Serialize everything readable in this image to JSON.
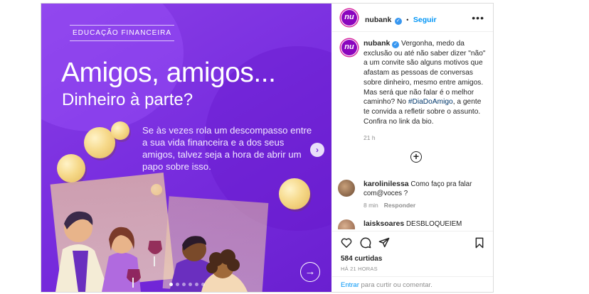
{
  "post_image": {
    "category": "EDUCAÇÃO FINANCEIRA",
    "headline": "Amigos, amigos...",
    "subheadline": "Dinheiro à parte?",
    "body": "Se às vezes rola um descompasso entre a sua vida financeira e a dos seus amigos, talvez seja a hora de abrir um papo sobre isso.",
    "next_arrow": "›",
    "carousel_dots": 6,
    "active_dot": 0,
    "circle_arrow": "→"
  },
  "header": {
    "avatar_text": "nu",
    "username": "nubank",
    "separator": "•",
    "follow_label": "Seguir",
    "more_icon": "•••"
  },
  "caption": {
    "avatar_text": "nu",
    "username": "nubank",
    "text_before_hashtag": "Vergonha, medo da exclusão ou até não saber dizer \"não\" a um convite são alguns motivos que afastam as pessoas de conversas sobre dinheiro, mesmo entre amigos. Mas será que não falar é o melhor caminho? No ",
    "hashtag": "#DiaDoAmigo",
    "text_after_hashtag": ", a gente te convida a refletir sobre o assunto. Confira no link da bio.",
    "time": "21 h"
  },
  "load_more_icon": "+",
  "comments": [
    {
      "username": "karolinilessa",
      "text": "Como faço pra falar com@voces ?",
      "time": "8 min",
      "reply_label": "Responder"
    },
    {
      "username": "laisksoares",
      "text": "DESBLOQUEIEM NINHA"
    }
  ],
  "stats": {
    "likes": "584 curtidas",
    "posted": "HÁ 21 HORAS"
  },
  "add_comment": {
    "login_label": "Entrar",
    "rest": " para curtir ou comentar."
  },
  "colors": {
    "brand_purple": "#8a05be",
    "link_blue": "#0095f6",
    "verified_blue": "#3897f0"
  }
}
